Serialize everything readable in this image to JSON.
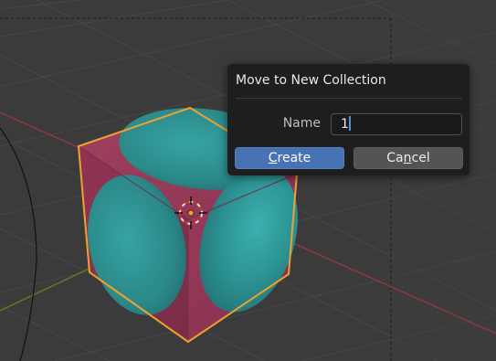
{
  "dialog": {
    "title": "Move to New Collection",
    "name_label": "Name",
    "name_value": "1",
    "create_button": {
      "underlined": "C",
      "rest": "reate"
    },
    "cancel_button": {
      "before": "Ca",
      "underlined": "n",
      "after": "cel"
    }
  },
  "viewport": {
    "icon": "object-origin-icon",
    "colors": {
      "background": "#3b3b3b",
      "grid": "#464646",
      "x_axis": "#8b3a3f",
      "y_axis": "#5b7a2a",
      "cube_face": "#8c3552",
      "sphere": "#2c8c8c",
      "selection_outline": "#f0a030"
    }
  }
}
